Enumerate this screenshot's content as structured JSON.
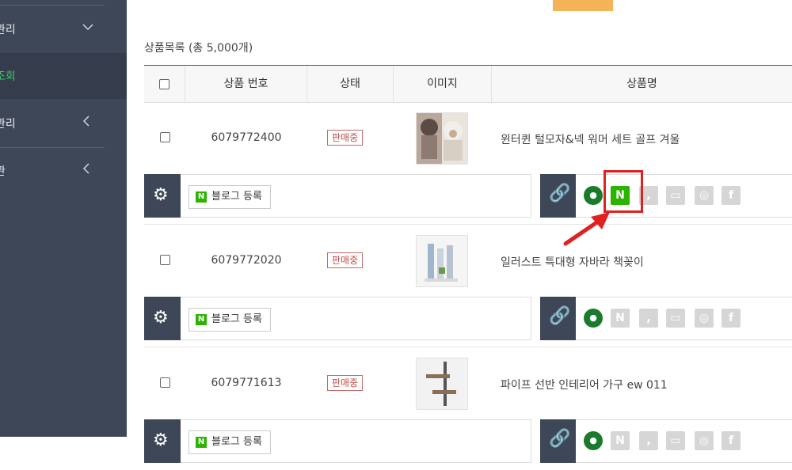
{
  "sidebar": {
    "items": [
      {
        "label": "관리",
        "chevron": "⌄",
        "active": false
      },
      {
        "label": "조회",
        "chevron": "",
        "active": true
      },
      {
        "label": "관리",
        "chevron": "‹",
        "active": false
      },
      {
        "label": "관",
        "chevron": "‹",
        "active": false
      }
    ]
  },
  "list_title": "상품목록 (총 5,000개)",
  "table": {
    "headers": [
      "상품 번호",
      "상태",
      "이미지",
      "상품명"
    ],
    "rows": [
      {
        "id": "6079772400",
        "status": "판매중",
        "name": "윈터퀸 털모자&넥 워머 세트 골프 겨울"
      },
      {
        "id": "6079772020",
        "status": "판매중",
        "name": "일러스트 특대형 자바라 책꽂이"
      },
      {
        "id": "6079771613",
        "status": "판매중",
        "name": "파이프 선반 인테리어 가구 ew 011"
      }
    ]
  },
  "blog_button_label": "블로그 등록",
  "colors": {
    "sidebar": "#3e4758",
    "naver_green": "#2db400",
    "highlight_red": "#e12020",
    "status_red": "#c0504d"
  }
}
